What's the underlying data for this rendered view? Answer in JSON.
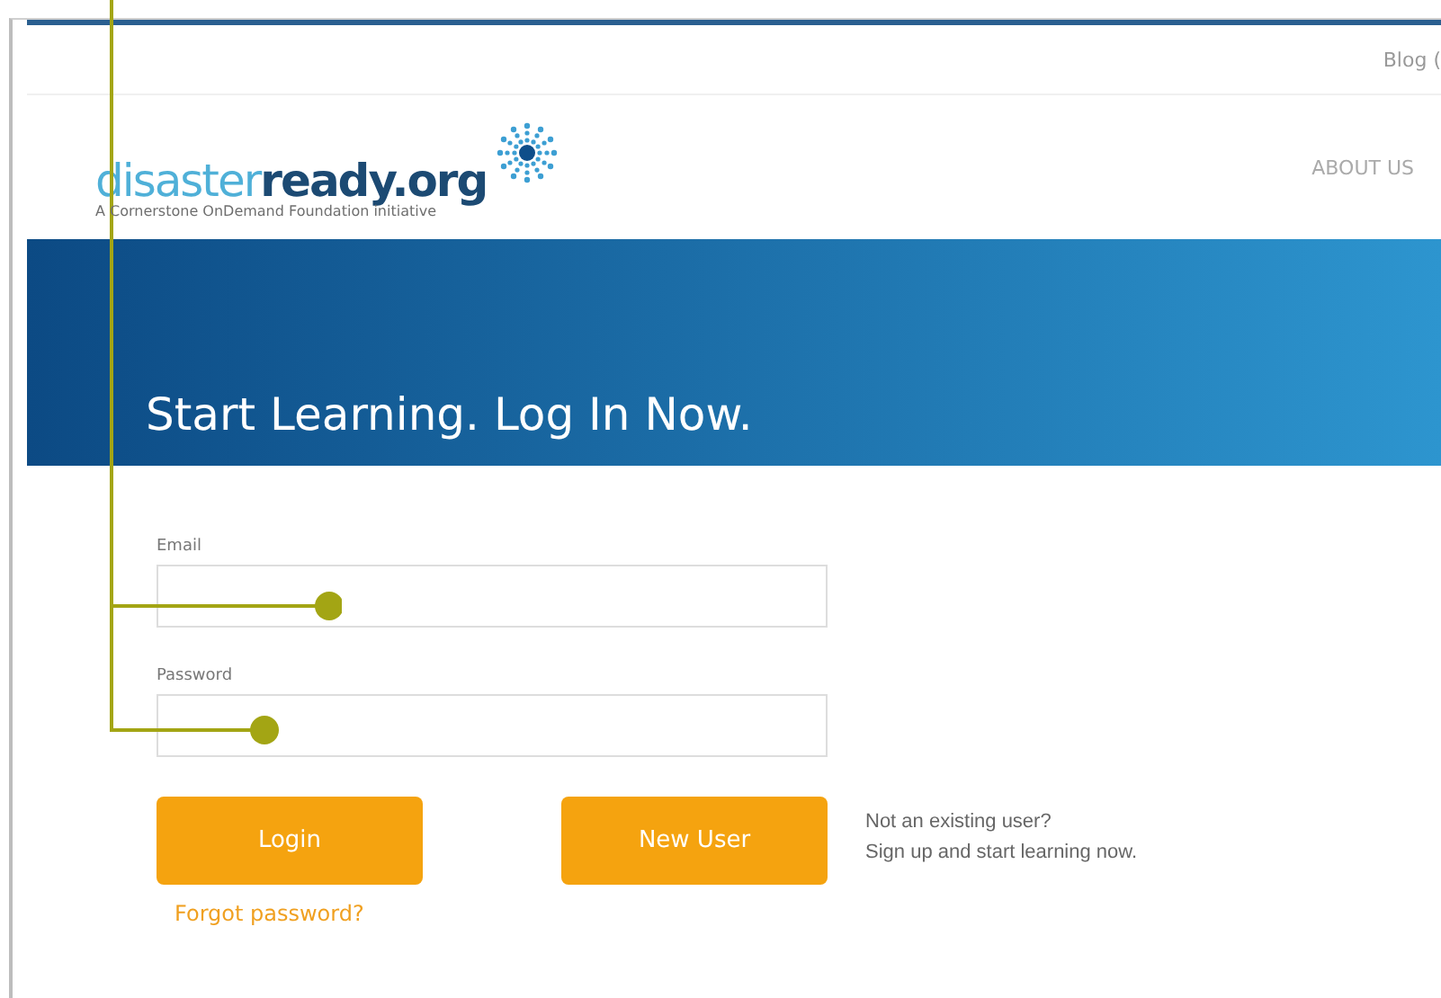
{
  "top_bar": {
    "links": [
      "Blog ("
    ]
  },
  "logo": {
    "wordmark": "disaster**ready.org**",
    "tagline": "A Cornerstone OnDemand Foundation initiative"
  },
  "nav": {
    "items": [
      "ABOUT US"
    ]
  },
  "banner": {
    "heading": "Start Learning. Log In Now."
  },
  "form": {
    "fields": [
      {
        "label": "Email"
      },
      {
        "label": "Password"
      }
    ],
    "login_button": "Login",
    "new_user_button": "New User",
    "new_user_note": [
      "Not an existing user?",
      "Sign up and start learning now."
    ],
    "forgot_link": "Forgot password?"
  }
}
